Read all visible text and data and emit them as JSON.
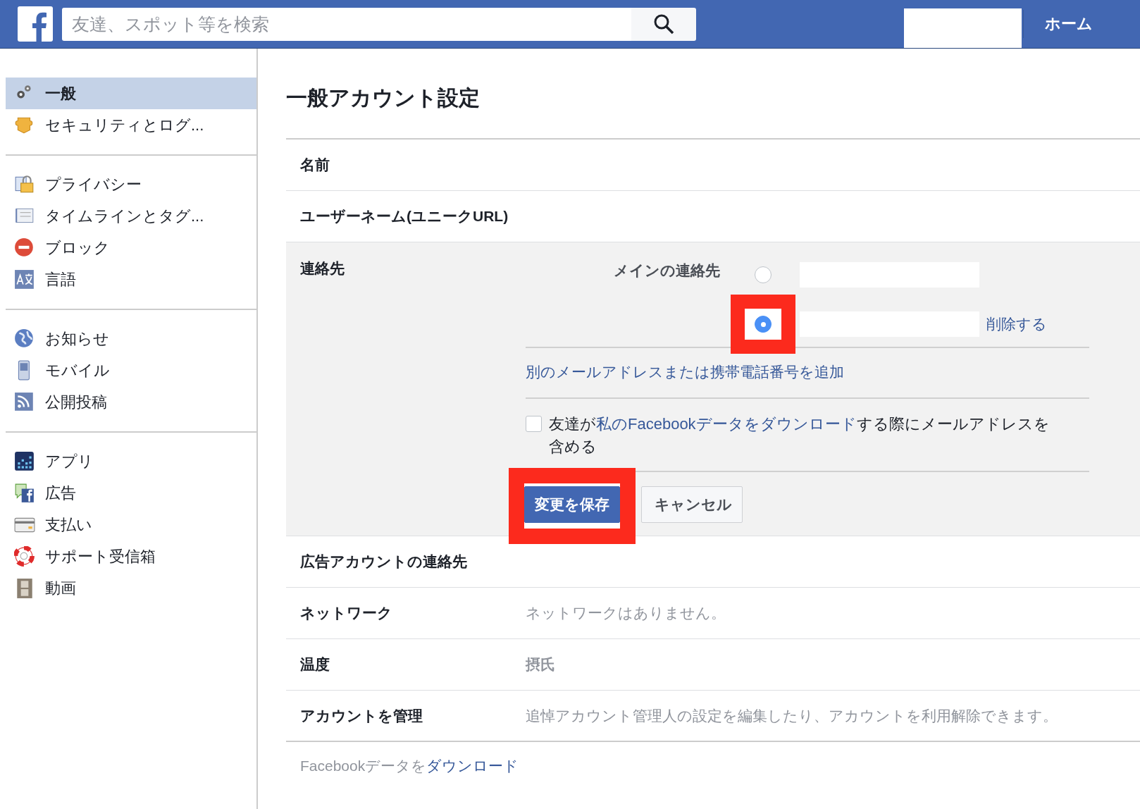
{
  "header": {
    "search": {
      "placeholder": "友達、スポット等を検索"
    },
    "nav": [
      {
        "label": "ホーム"
      }
    ]
  },
  "sidebar": {
    "groups": [
      {
        "items": [
          {
            "label": "一般",
            "selected": true
          },
          {
            "label": "セキュリティとログ...",
            "selected": false
          }
        ]
      },
      {
        "items": [
          {
            "label": "プライバシー",
            "selected": false
          },
          {
            "label": "タイムラインとタグ...",
            "selected": false
          },
          {
            "label": "ブロック",
            "selected": false
          },
          {
            "label": "言語",
            "selected": false
          }
        ]
      },
      {
        "items": [
          {
            "label": "お知らせ",
            "selected": false
          },
          {
            "label": "モバイル",
            "selected": false
          },
          {
            "label": "公開投稿",
            "selected": false
          }
        ]
      },
      {
        "items": [
          {
            "label": "アプリ",
            "selected": false
          },
          {
            "label": "広告",
            "selected": false
          },
          {
            "label": "支払い",
            "selected": false
          },
          {
            "label": "サポート受信箱",
            "selected": false
          },
          {
            "label": "動画",
            "selected": false
          }
        ]
      }
    ]
  },
  "main": {
    "title": "一般アカウント設定",
    "rows": [
      {
        "label": "名前"
      },
      {
        "label": "ユーザーネーム(ユニークURL)"
      }
    ],
    "contact": {
      "label": "連絡先",
      "main_label": "メインの連絡先",
      "options": [
        {
          "selected": false
        },
        {
          "selected": true
        }
      ],
      "remove_link": "削除する",
      "add_link": "別のメールアドレスまたは携帯電話番号を追加",
      "include_checkbox": {
        "checked": false,
        "text_before": "友達が",
        "link": "私のFacebookデータをダウンロード",
        "text_after": "する際にメールアドレスを含める"
      },
      "save_button": "変更を保存",
      "cancel_button": "キャンセル"
    },
    "rows_after": [
      {
        "label": "広告アカウントの連絡先"
      },
      {
        "label": "ネットワーク",
        "value": "ネットワークはありません。"
      },
      {
        "label": "温度",
        "value": "摂氏",
        "kind": "strong"
      },
      {
        "label": "アカウントを管理",
        "value": "追悼アカウント管理人の設定を編集したり、アカウントを利用解除できます。"
      }
    ],
    "footer": {
      "text": "Facebookデータを",
      "link": "ダウンロード"
    }
  }
}
